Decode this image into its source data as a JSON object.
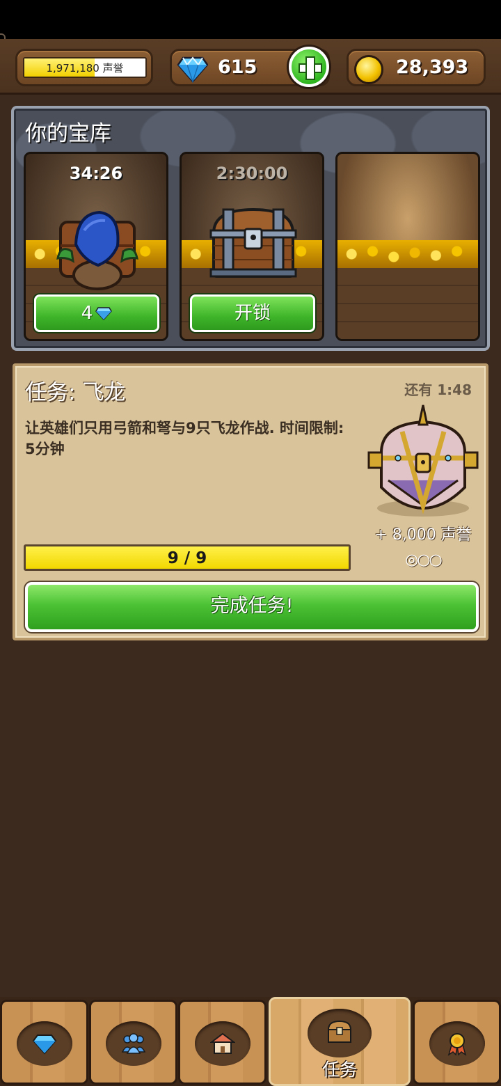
{
  "header": {
    "reputation_text": "1,971,180 声誉",
    "reputation_progress": 0.58,
    "gems": "615",
    "gold": "28,393"
  },
  "vault": {
    "title": "你的宝库",
    "slots": [
      {
        "timer": "34:26",
        "button_label": "4",
        "button_icon": "diamond-icon",
        "content": "goblin-chest"
      },
      {
        "timer": "2:30:00",
        "button_label": "开锁",
        "content": "wooden-chest"
      },
      {
        "content": "empty-gold-pile"
      }
    ]
  },
  "quest": {
    "title": "任务: 飞龙",
    "remaining": "还有 1:48",
    "description": "让英雄们只用弓箭和弩与9只飞龙作战. 时间限制: 5分钟",
    "progress_text": "9 / 9",
    "progress": 1.0,
    "reward": "+ 8,000 声誉",
    "reward_tiers": "◎○○",
    "complete_label": "完成任务!"
  },
  "nav": {
    "tabs": [
      {
        "icon": "diamond-icon",
        "label": ""
      },
      {
        "icon": "people-icon",
        "label": ""
      },
      {
        "icon": "house-icon",
        "label": ""
      },
      {
        "icon": "chest-icon",
        "label": "任务",
        "active": true
      },
      {
        "icon": "medal-icon",
        "label": ""
      }
    ]
  },
  "colors": {
    "background": "#3c2a1e",
    "button_green": "#4cc235",
    "progress_yellow": "#f4dd00",
    "parchment": "#d9c39a"
  }
}
